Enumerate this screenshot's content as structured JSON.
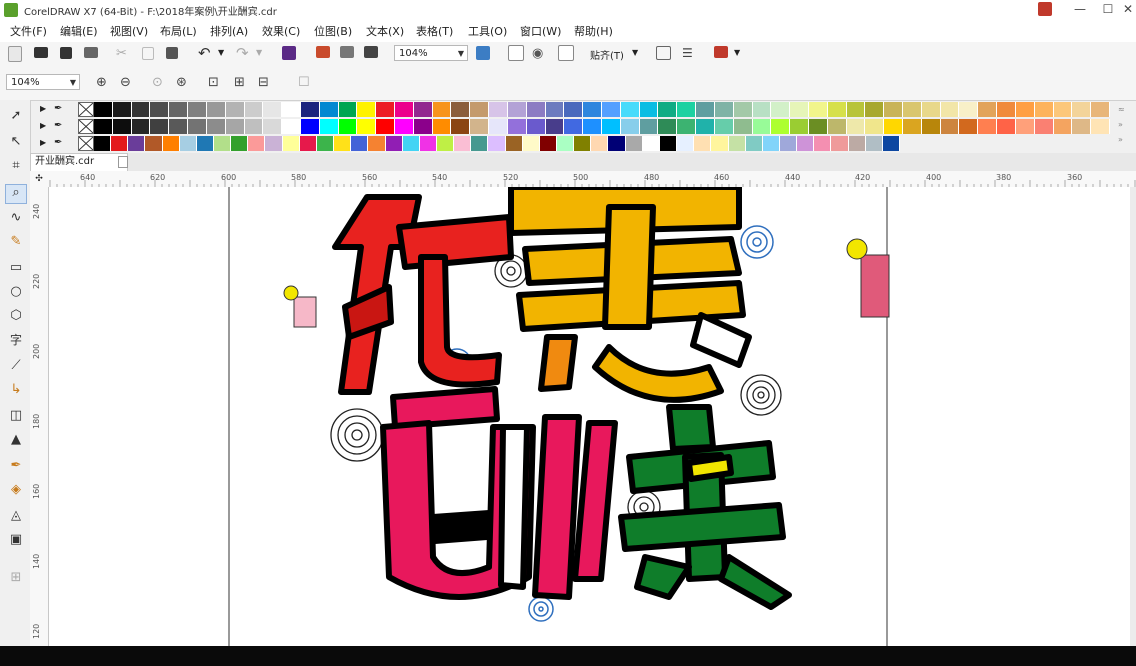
{
  "window": {
    "title": "CorelDRAW X7 (64-Bit) - F:\\2018年案例\\开业酬宾.cdr",
    "minimize_glyph": "—",
    "maximize_glyph": "☐",
    "close_glyph": "✕"
  },
  "menubar": {
    "items": [
      "文件(F)",
      "编辑(E)",
      "视图(V)",
      "布局(L)",
      "排列(A)",
      "效果(C)",
      "位图(B)",
      "文本(X)",
      "表格(T)",
      "工具(O)",
      "窗口(W)",
      "帮助(H)"
    ]
  },
  "standard_toolbar": {
    "zoom_value": "104%",
    "snap_label": "贴齐(T)"
  },
  "property_bar": {
    "zoom_value": "104%"
  },
  "document": {
    "tab_label": "开业酬宾.cdr"
  },
  "ruler": {
    "h_ticks": [
      "640",
      "620",
      "600",
      "580",
      "560",
      "540",
      "520",
      "500",
      "480",
      "460",
      "440",
      "420",
      "400",
      "380",
      "360"
    ],
    "v_ticks": [
      "240",
      "220",
      "200",
      "180",
      "160",
      "140",
      "120"
    ]
  },
  "artwork": {
    "characters": [
      {
        "char": "优",
        "color": "#e8221f"
      },
      {
        "char": "惠",
        "color": "#f2b400"
      },
      {
        "char": "酬",
        "color": "#e8185c"
      },
      {
        "char": "宾",
        "color": "#0f7d2a"
      }
    ]
  },
  "colors": {
    "accent_blue": "#2f6fbe",
    "palette_row1": [
      "#000000",
      "#1a1a1a",
      "#333333",
      "#4d4d4d",
      "#666666",
      "#808080",
      "#999999",
      "#b3b3b3",
      "#cccccc",
      "#e6e6e6",
      "#ffffff",
      "#1a237e",
      "#0288d1",
      "#00a651",
      "#fff200",
      "#ed1c24",
      "#ec008c",
      "#92278f",
      "#f7941d",
      "#8b5e3c",
      "#c49a6c",
      "#d7c4e8",
      "#b3a2d6",
      "#8c7cc3",
      "#6c7bbf",
      "#4a69bd",
      "#2e86de",
      "#54a0ff",
      "#48dbfb",
      "#0abde3",
      "#10ac84",
      "#1dd1a1",
      "#5f9ea0",
      "#7fb3a6",
      "#a3c9a8",
      "#b8e0c4",
      "#d2f0c8",
      "#e6f5b8",
      "#f1f58b",
      "#d6e04a",
      "#b8c43a",
      "#a8a82e",
      "#c9b458",
      "#d9c66e",
      "#e8d88a",
      "#f2e6a8",
      "#f8f0c8",
      "#e2a35a",
      "#f08a3c",
      "#ff9f43",
      "#fdb35c",
      "#fcc77a",
      "#f3d49a",
      "#e8b67a"
    ],
    "palette_row2": [
      "#000000",
      "#0d0d0d",
      "#262626",
      "#404040",
      "#595959",
      "#737373",
      "#8c8c8c",
      "#a6a6a6",
      "#bfbfbf",
      "#d9d9d9",
      "#ffffff",
      "#0000ff",
      "#00ffff",
      "#00ff00",
      "#ffff00",
      "#ff0000",
      "#ff00ff",
      "#8b008b",
      "#ff8c00",
      "#8b4513",
      "#d2b48c",
      "#e6e6fa",
      "#9370db",
      "#6a5acd",
      "#483d8b",
      "#4169e1",
      "#1e90ff",
      "#00bfff",
      "#87ceeb",
      "#5f9ea0",
      "#2e8b57",
      "#3cb371",
      "#20b2aa",
      "#66cdaa",
      "#8fbc8f",
      "#98fb98",
      "#adff2f",
      "#9acd32",
      "#6b8e23",
      "#bdb76b",
      "#eee8aa",
      "#f0e68c",
      "#ffd700",
      "#daa520",
      "#b8860b",
      "#cd853f",
      "#d2691e",
      "#ff7f50",
      "#ff6347",
      "#ffa07a",
      "#fa8072",
      "#f4a460",
      "#deb887",
      "#ffe4b5"
    ],
    "palette_row3": [
      "#000000",
      "#e31a1c",
      "#6a3d9a",
      "#b15928",
      "#ff7f00",
      "#a6cee3",
      "#1f78b4",
      "#b2df8a",
      "#33a02c",
      "#fb9a99",
      "#cab2d6",
      "#ffff99",
      "#e6194b",
      "#3cb44b",
      "#ffe119",
      "#4363d8",
      "#f58231",
      "#911eb4",
      "#42d4f4",
      "#f032e6",
      "#bfef45",
      "#fabed4",
      "#469990",
      "#dcbeff",
      "#9a6324",
      "#fffac8",
      "#800000",
      "#aaffc3",
      "#808000",
      "#ffd8b1",
      "#000075",
      "#a9a9a9",
      "#ffffff",
      "#000000",
      "#e6f0ff",
      "#ffe0b2",
      "#fff59d",
      "#c5e1a5",
      "#80cbc4",
      "#81d4fa",
      "#9fa8da",
      "#ce93d8",
      "#f48fb1",
      "#ef9a9a",
      "#bcaaa4",
      "#b0bec5",
      "#0d47a1"
    ]
  }
}
